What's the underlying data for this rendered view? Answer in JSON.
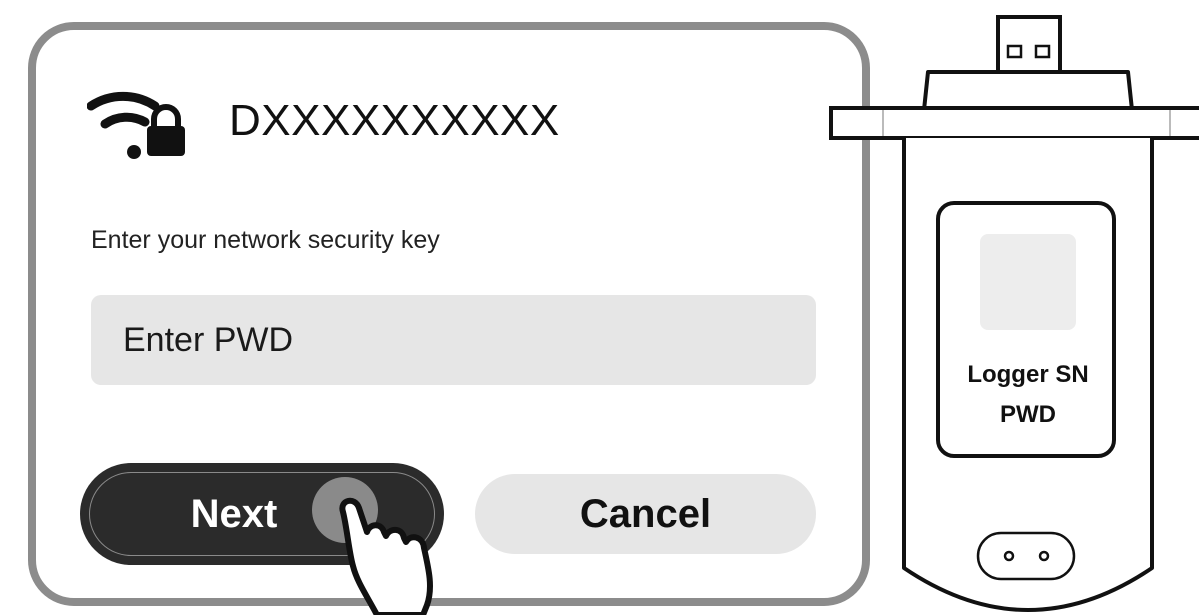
{
  "dialog": {
    "network_name": "DXXXXXXXXXX",
    "prompt": "Enter your network security key",
    "password_placeholder": "Enter PWD",
    "next_label": "Next",
    "cancel_label": "Cancel"
  },
  "device": {
    "label_line1": "Logger SN",
    "label_line2": "PWD"
  },
  "icons": {
    "network": "wifi-lock-icon",
    "pointer": "hand-pointer-icon"
  },
  "colors": {
    "dialog_border": "#8c8c8c",
    "primary_button": "#2b2b2b",
    "secondary_button": "#e6e6e6",
    "input_background": "#e6e6e6"
  }
}
